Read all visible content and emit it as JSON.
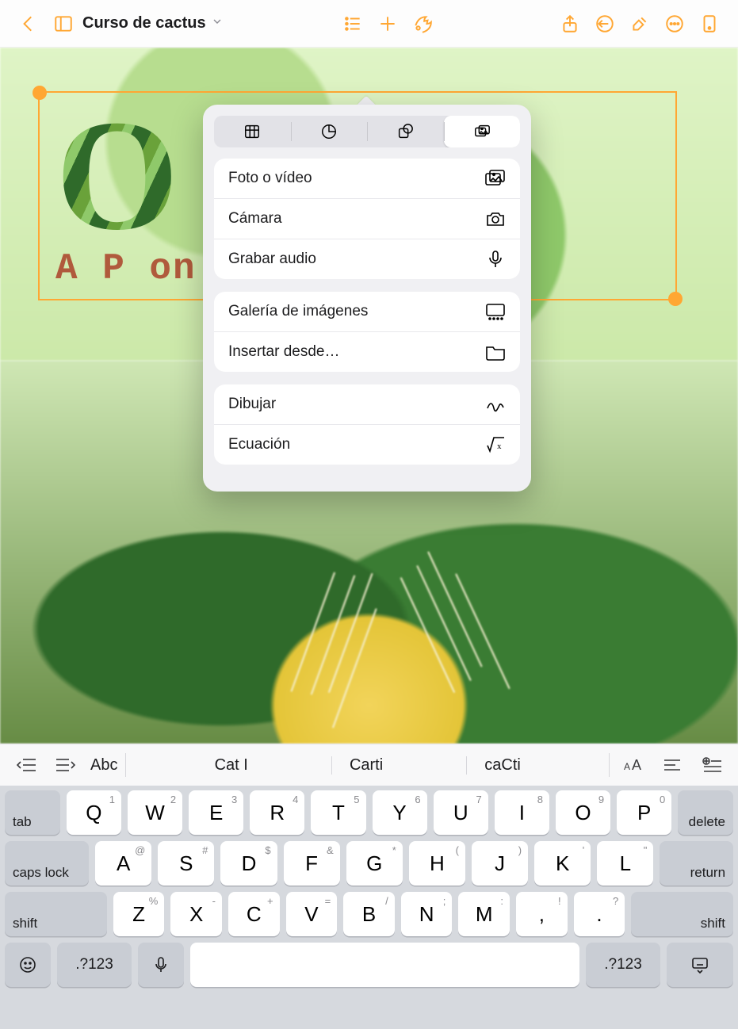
{
  "toolbar": {
    "doc_title": "Curso de cactus"
  },
  "document": {
    "big_title": "O          ti",
    "subtitle": "A P                    on"
  },
  "popover": {
    "group1": [
      {
        "label": "Foto o vídeo"
      },
      {
        "label": "Cámara"
      },
      {
        "label": "Grabar audio"
      }
    ],
    "group2": [
      {
        "label": "Galería de imágenes"
      },
      {
        "label": "Insertar desde…"
      }
    ],
    "group3": [
      {
        "label": "Dibujar"
      },
      {
        "label": "Ecuación"
      }
    ]
  },
  "shortcut": {
    "abc": "Abc",
    "suggestions": [
      "Cat I",
      "Carti",
      "caCti"
    ]
  },
  "keys": {
    "tab": "tab",
    "delete": "delete",
    "caps": "caps lock",
    "return": "return",
    "shift": "shift",
    "numbers": ".?123",
    "row1": [
      "Q",
      "W",
      "E",
      "R",
      "T",
      "Y",
      "U",
      "I",
      "O",
      "P"
    ],
    "row1_hints": [
      "1",
      "2",
      "3",
      "4",
      "5",
      "6",
      "7",
      "8",
      "9",
      "0"
    ],
    "row2": [
      "A",
      "S",
      "D",
      "F",
      "G",
      "H",
      "J",
      "K",
      "L"
    ],
    "row2_hints": [
      "@",
      "#",
      "$",
      "&",
      "*",
      "(",
      ")",
      "'",
      "\""
    ],
    "row3": [
      "Z",
      "X",
      "C",
      "V",
      "B",
      "N",
      "M",
      ",",
      "."
    ],
    "row3_hints": [
      "%",
      "-",
      "+",
      "=",
      "/",
      ";",
      ":",
      "!",
      "?"
    ]
  }
}
